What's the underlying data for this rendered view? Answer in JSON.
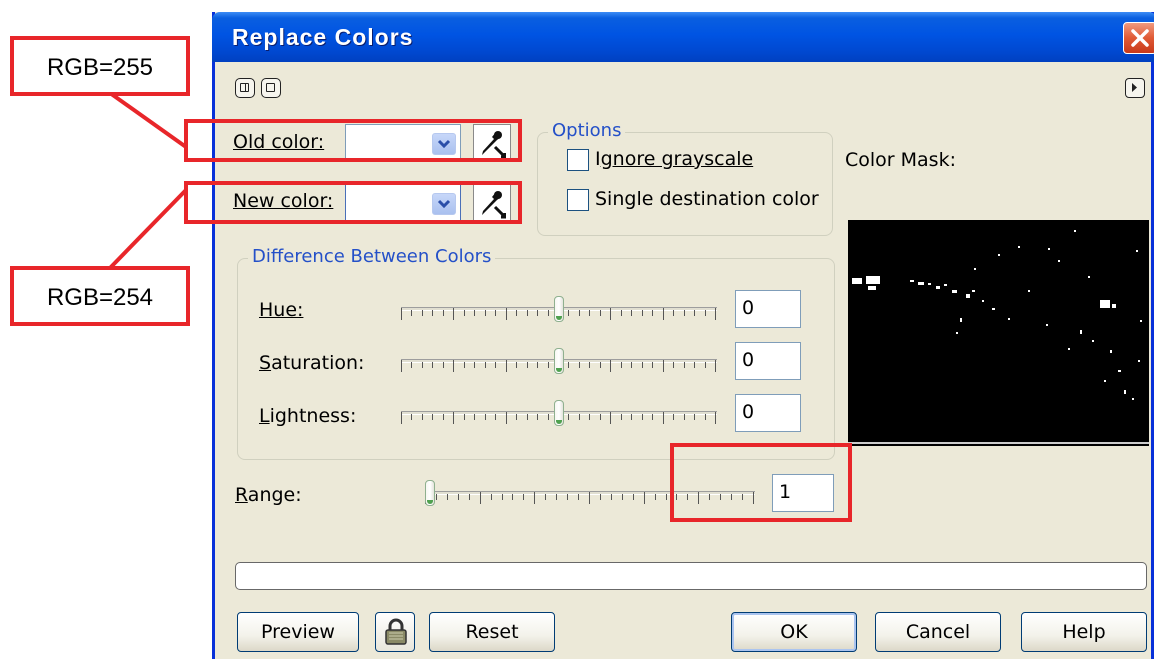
{
  "dialog": {
    "title": "Replace Colors",
    "old_color_label": "Old color:",
    "new_color_label": "New color:",
    "options": {
      "title": "Options",
      "ignore_grayscale": "Ignore grayscale",
      "single_destination": "Single destination color",
      "ignore_grayscale_checked": false,
      "single_destination_checked": false
    },
    "color_mask_label": "Color Mask:",
    "difference": {
      "title": "Difference Between Colors",
      "hue_label": "Hue:",
      "hue_value": "0",
      "saturation_label": "Saturation:",
      "saturation_value": "0",
      "lightness_label": "Lightness:",
      "lightness_value": "0"
    },
    "range_label": "Range:",
    "range_value": "1",
    "buttons": {
      "preview": "Preview",
      "reset": "Reset",
      "ok": "OK",
      "cancel": "Cancel",
      "help": "Help"
    }
  },
  "annotations": {
    "old_color_callout": "RGB=255",
    "new_color_callout": "RGB=254"
  },
  "colors": {
    "annotation_red": "#e8262a",
    "dialog_background": "#ece9d8",
    "titlebar_blue": "#0054e3",
    "group_title_blue": "#2450c8"
  }
}
